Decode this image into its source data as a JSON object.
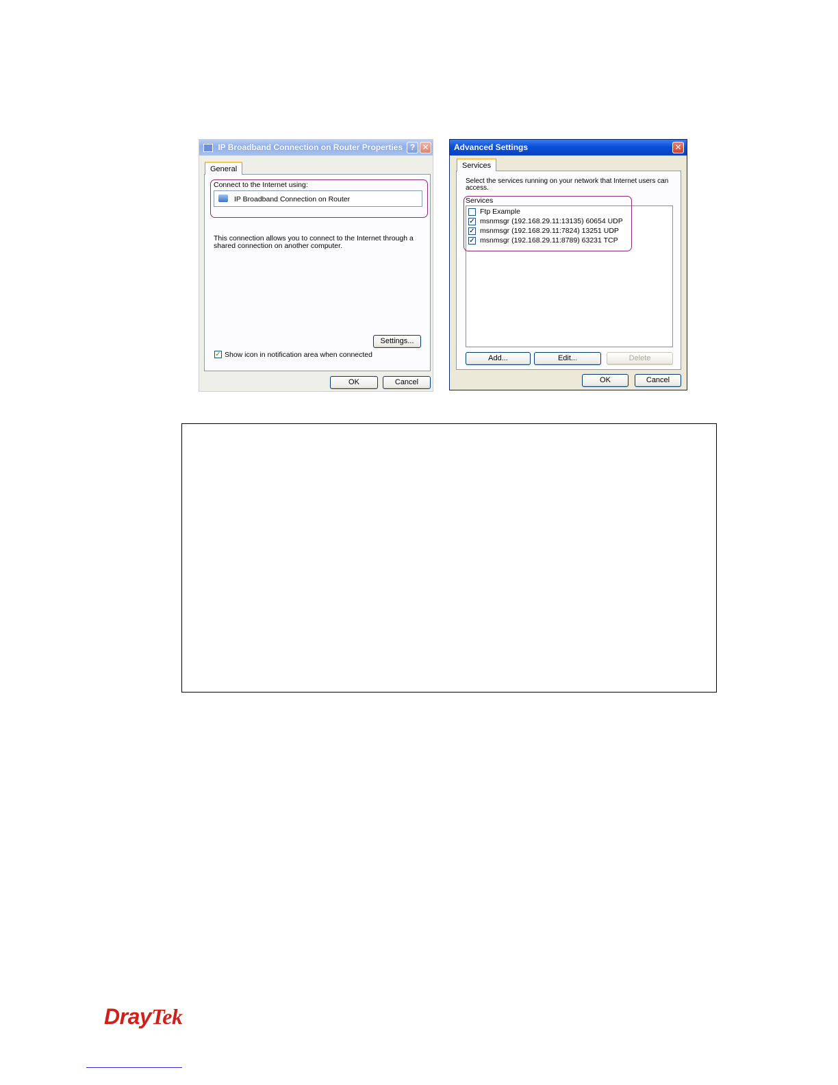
{
  "left_dialog": {
    "title": "IP Broadband Connection on Router Properties",
    "help_button": "?",
    "close_button": "✕",
    "tab_general": "General",
    "connect_label": "Connect to the Internet using:",
    "connection_name": "IP Broadband Connection on Router",
    "description": "This connection allows you to connect to the Internet through a shared connection on another computer.",
    "settings_button": "Settings...",
    "show_icon_label": "Show icon in notification area when connected",
    "show_icon_checked": true,
    "ok_button": "OK",
    "cancel_button": "Cancel"
  },
  "right_dialog": {
    "title": "Advanced Settings",
    "close_button": "✕",
    "tab_services": "Services",
    "instruction": "Select the services running on your network that Internet users can access.",
    "services_label": "Services",
    "services": [
      {
        "name": "Ftp Example",
        "checked": false
      },
      {
        "name": "msnmsgr (192.168.29.11:13135) 60654 UDP",
        "checked": true
      },
      {
        "name": "msnmsgr (192.168.29.11:7824) 13251 UDP",
        "checked": true
      },
      {
        "name": "msnmsgr (192.168.29.11:8789) 63231 TCP",
        "checked": true
      }
    ],
    "add_button": "Add...",
    "edit_button": "Edit...",
    "delete_button": "Delete",
    "ok_button": "OK",
    "cancel_button": "Cancel"
  },
  "footer": {
    "logo_dray": "Dray",
    "logo_tek": "Tek"
  },
  "colors": {
    "highlight": "#8b2a7a",
    "logo_red": "#d0201a",
    "xp_blue": "#0a4fd8"
  }
}
